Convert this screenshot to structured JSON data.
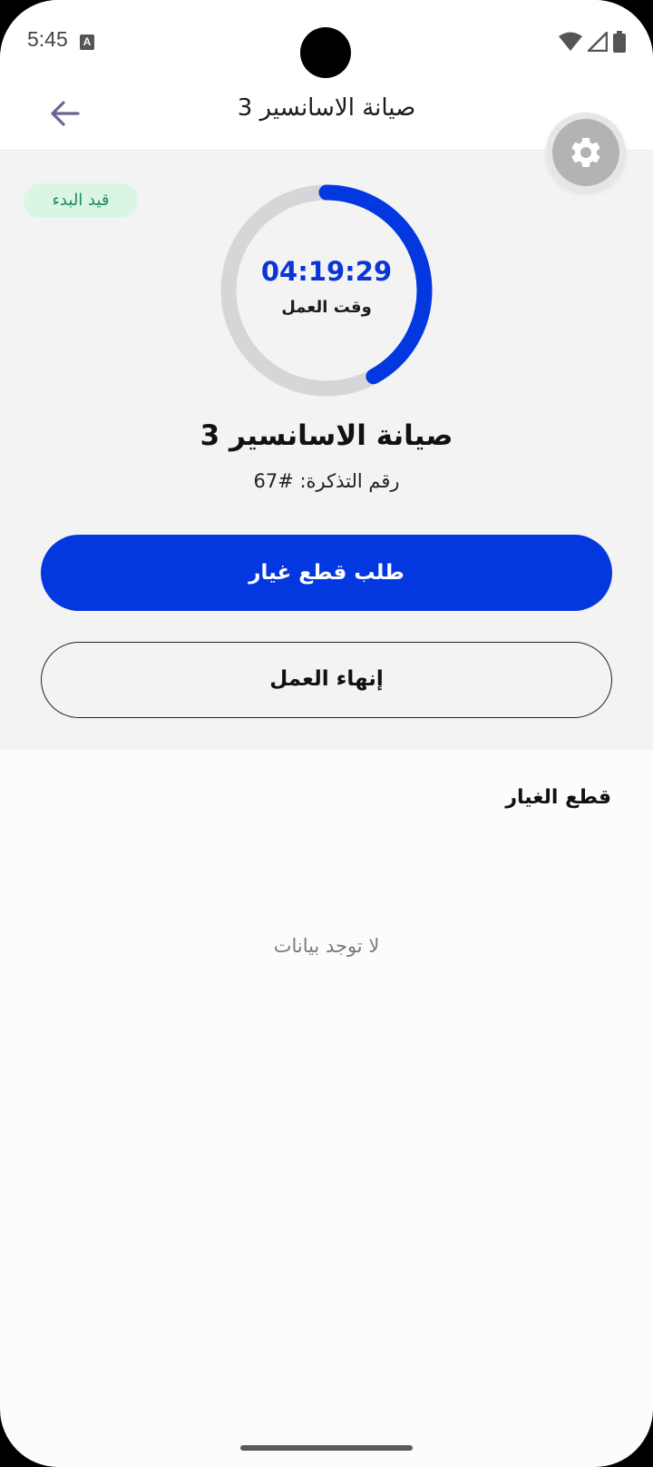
{
  "status_bar": {
    "time": "5:45",
    "notification_icon_letter": "A"
  },
  "app_bar": {
    "title": "صيانة الاسانسير 3",
    "back_icon": "arrow-left-icon"
  },
  "settings_fab": {
    "icon": "gear-icon"
  },
  "job": {
    "status_badge": "قيد البدء",
    "timer_value": "04:19:29",
    "timer_label": "وقت العمل",
    "timer_progress_fraction": 0.42,
    "title": "صيانة الاسانسير 3",
    "ticket_number": "رقم التذكرة: #67"
  },
  "actions": {
    "request_parts_label": "طلب قطع غيار",
    "finish_work_label": "إنهاء العمل"
  },
  "parts": {
    "title": "قطع الغيار",
    "empty_text": "لا توجد بيانات"
  },
  "colors": {
    "accent": "#0338e0",
    "badge_bg": "#d8f6e3",
    "badge_text": "#1f8c52",
    "ring_track": "#d6d6d8"
  }
}
